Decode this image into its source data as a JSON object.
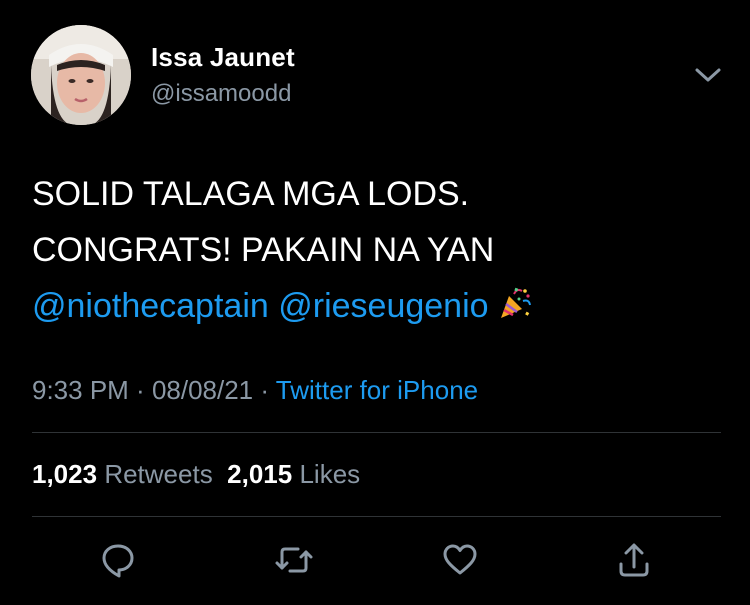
{
  "author": {
    "name": "Issa Jaunet",
    "handle": "@issamoodd",
    "avatar": "profile-photo"
  },
  "tweet": {
    "line1": "SOLID TALAGA MGA LODS.",
    "line2": "CONGRATS! PAKAIN NA YAN",
    "mentions": [
      "@niothecaptain",
      "@rieseugenio"
    ],
    "emoji": "party-popper-icon"
  },
  "meta": {
    "time": "9:33 PM",
    "sep1": " · ",
    "date": "08/08/21",
    "sep2": " · ",
    "source": "Twitter for iPhone"
  },
  "stats": {
    "retweets_count": "1,023",
    "retweets_label": "Retweets",
    "likes_count": "2,015",
    "likes_label": "Likes"
  },
  "actions": [
    "reply-icon",
    "retweet-icon",
    "like-icon",
    "share-icon"
  ],
  "colors": {
    "background": "#000000",
    "text": "#ffffff",
    "secondary": "#8b98a5",
    "accent": "#1d9bf0",
    "divider": "#2f3336"
  }
}
